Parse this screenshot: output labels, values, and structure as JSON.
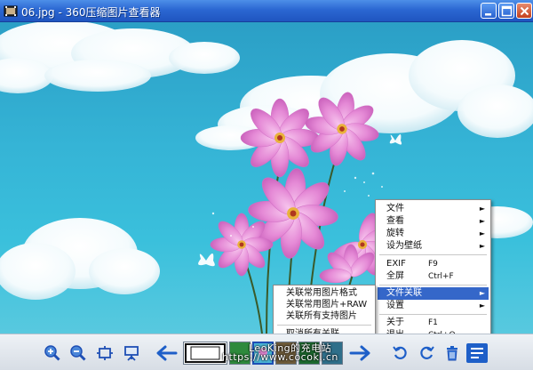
{
  "window": {
    "title": "06.jpg - 360压缩图片查看器",
    "minimize_label": "minimize",
    "maximize_label": "maximize",
    "close_label": "close"
  },
  "image": {
    "description_icon": "photo-flowers-sky"
  },
  "toolbar": {
    "buttons": [
      {
        "name": "zoom-in-icon"
      },
      {
        "name": "zoom-out-icon"
      },
      {
        "name": "fit-window-icon"
      },
      {
        "name": "slideshow-icon"
      },
      {
        "name": "prev-arrow-icon"
      },
      {
        "name": "next-arrow-icon"
      },
      {
        "name": "rotate-left-icon"
      },
      {
        "name": "rotate-right-icon"
      },
      {
        "name": "delete-icon"
      },
      {
        "name": "menu-icon"
      }
    ],
    "watermark_line1": "LeoKing的充电站",
    "watermark_line2": "https://www.cocokl.cn"
  },
  "context_menu": {
    "items": [
      {
        "label": "文件",
        "submenu": true
      },
      {
        "label": "查看",
        "submenu": true
      },
      {
        "label": "旋转",
        "submenu": true
      },
      {
        "label": "设为壁纸",
        "submenu": true
      },
      {
        "label": "EXIF",
        "shortcut": "F9"
      },
      {
        "label": "全屏",
        "shortcut": "Ctrl+F"
      },
      {
        "label": "文件关联",
        "submenu": true,
        "highlighted": true
      },
      {
        "label": "设置",
        "submenu": true
      },
      {
        "label": "关于",
        "shortcut": "F1"
      },
      {
        "label": "退出",
        "shortcut": "Ctrl+Q"
      }
    ]
  },
  "submenu": {
    "items": [
      {
        "label": "关联常用图片格式"
      },
      {
        "label": "关联常用图片+RAW"
      },
      {
        "label": "关联所有支持图片"
      },
      {
        "label": "取消所有关联"
      }
    ]
  },
  "colors": {
    "titlebar": "#2b67d2",
    "menu_highlight": "#3567c9",
    "sky": "#35b4d6",
    "flower": "#e58ad6"
  }
}
